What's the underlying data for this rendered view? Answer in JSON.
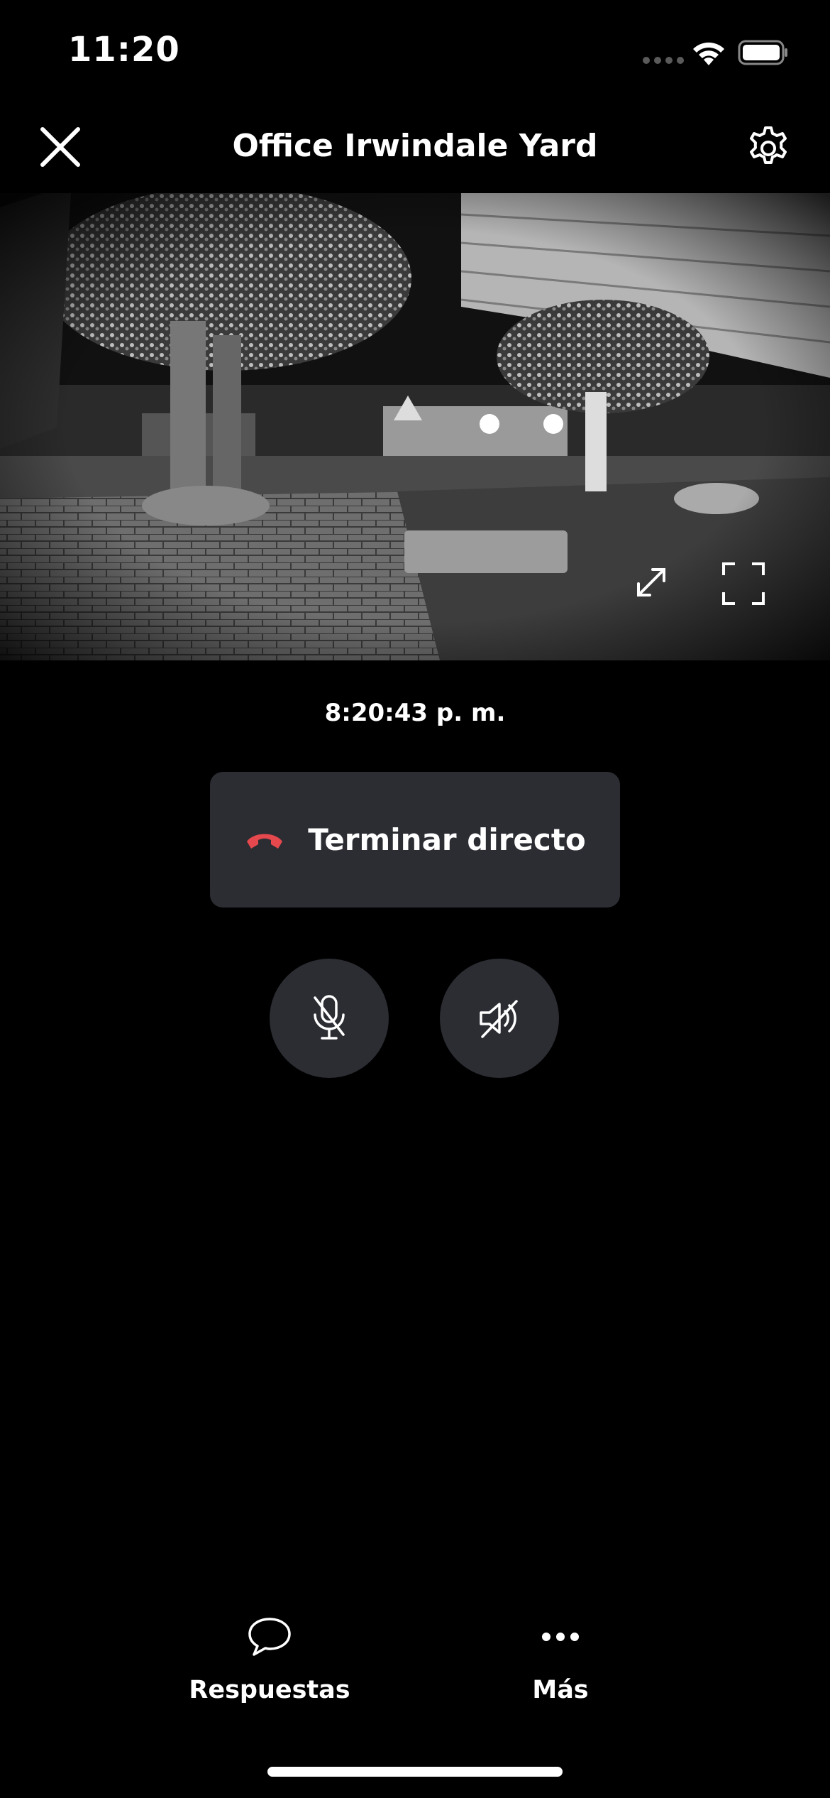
{
  "status_bar": {
    "time": "11:20",
    "icons": [
      "signal-dots-icon",
      "wifi-icon",
      "battery-icon"
    ]
  },
  "header": {
    "title": "Office Irwindale Yard",
    "close_icon": "close-icon",
    "settings_icon": "gear-icon"
  },
  "video": {
    "overlay_icons": [
      "expand-icon",
      "fullscreen-icon"
    ]
  },
  "timestamp": "8:20:43 p. m.",
  "end_live": {
    "label": "Terminar directo",
    "icon": "hang-up-phone-icon",
    "icon_color": "#e5484d"
  },
  "controls": [
    {
      "name": "mic-muted",
      "icon": "mic-off-icon"
    },
    {
      "name": "speaker-muted",
      "icon": "speaker-off-icon"
    }
  ],
  "bottom_nav": {
    "replies_label": "Respuestas",
    "more_label": "Más"
  },
  "colors": {
    "background": "#000000",
    "button_bg": "#2b2d33",
    "accent_red": "#e5484d"
  }
}
